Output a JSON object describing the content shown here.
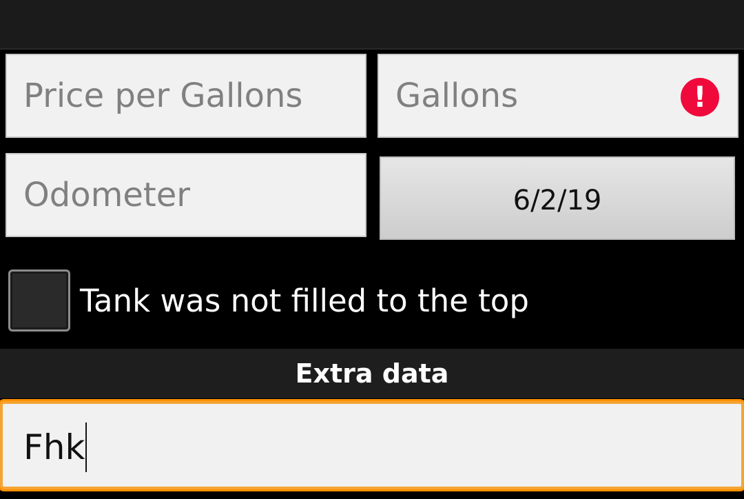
{
  "form": {
    "price_placeholder": "Price per Gallons",
    "gallons_placeholder": "Gallons",
    "gallons_error_icon": "error-exclamation-icon",
    "odometer_placeholder": "Odometer",
    "date_value": "6/2/19",
    "partial_fill_label": "Tank was not filled to the top",
    "partial_fill_checked": false
  },
  "extra": {
    "header": "Extra data",
    "value": "Fhk"
  },
  "colors": {
    "error": "#f00a3c",
    "focus": "#ff8f00",
    "background": "#000000"
  }
}
